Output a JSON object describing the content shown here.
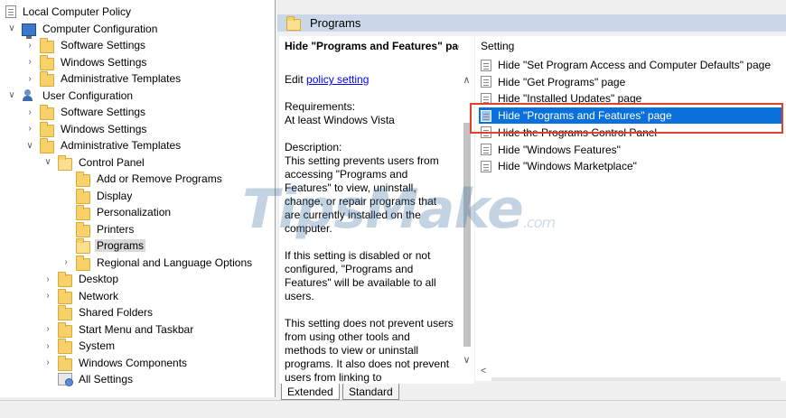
{
  "tree": {
    "items": [
      {
        "label": "Local Computer Policy",
        "chev": "",
        "icon": "doc"
      },
      {
        "label": "Computer Configuration",
        "chev": "v",
        "icon": "computer"
      },
      {
        "label": "Software Settings",
        "chev": ">",
        "icon": "folder"
      },
      {
        "label": "Windows Settings",
        "chev": ">",
        "icon": "folder"
      },
      {
        "label": "Administrative Templates",
        "chev": ">",
        "icon": "folder"
      },
      {
        "label": "User Configuration",
        "chev": "v",
        "icon": "user"
      },
      {
        "label": "Software Settings",
        "chev": ">",
        "icon": "folder"
      },
      {
        "label": "Windows Settings",
        "chev": ">",
        "icon": "folder"
      },
      {
        "label": "Administrative Templates",
        "chev": "v",
        "icon": "folder"
      },
      {
        "label": "Control Panel",
        "chev": "v",
        "icon": "folder-open"
      },
      {
        "label": "Add or Remove Programs",
        "chev": "",
        "icon": "folder"
      },
      {
        "label": "Display",
        "chev": "",
        "icon": "folder"
      },
      {
        "label": "Personalization",
        "chev": "",
        "icon": "folder"
      },
      {
        "label": "Printers",
        "chev": "",
        "icon": "folder"
      },
      {
        "label": "Programs",
        "chev": "",
        "icon": "folder-open",
        "selected": true
      },
      {
        "label": "Regional and Language Options",
        "chev": ">",
        "icon": "folder"
      },
      {
        "label": "Desktop",
        "chev": ">",
        "icon": "folder"
      },
      {
        "label": "Network",
        "chev": ">",
        "icon": "folder"
      },
      {
        "label": "Shared Folders",
        "chev": "",
        "icon": "folder"
      },
      {
        "label": "Start Menu and Taskbar",
        "chev": ">",
        "icon": "folder"
      },
      {
        "label": "System",
        "chev": ">",
        "icon": "folder"
      },
      {
        "label": "Windows Components",
        "chev": ">",
        "icon": "folder"
      },
      {
        "label": "All Settings",
        "chev": "",
        "icon": "settings"
      }
    ]
  },
  "header": {
    "title": "Programs"
  },
  "description": {
    "title": "Hide \"Programs and Features\" page",
    "edit_prefix": "Edit ",
    "edit_link": "policy setting",
    "requirements_label": "Requirements:",
    "requirements_value": "At least Windows Vista",
    "description_label": "Description:",
    "para1": "This setting prevents users from accessing \"Programs and Features\" to view, uninstall, change, or repair programs that are currently installed on the computer.",
    "para2": "If this setting is disabled or not configured, \"Programs and Features\" will be available to all users.",
    "para3": "This setting does not prevent users from using other tools and methods to view or uninstall programs.  It also does not prevent users from linking to"
  },
  "list": {
    "column": "Setting",
    "items": [
      {
        "label": "Hide \"Set Program Access and Computer Defaults\" page"
      },
      {
        "label": "Hide \"Get Programs\" page"
      },
      {
        "label": "Hide \"Installed Updates\" page"
      },
      {
        "label": "Hide \"Programs and Features\" page",
        "selected": true
      },
      {
        "label": "Hide the Programs Control Panel"
      },
      {
        "label": "Hide \"Windows Features\""
      },
      {
        "label": "Hide \"Windows Marketplace\""
      }
    ]
  },
  "tabs": {
    "extended": "Extended",
    "standard": "Standard"
  },
  "watermark": {
    "main": "TipsMake",
    "suffix": ".com"
  },
  "colors": {
    "selection": "#0a70dc",
    "highlight_box": "#e0402d",
    "header_bg": "#cad8ea"
  }
}
